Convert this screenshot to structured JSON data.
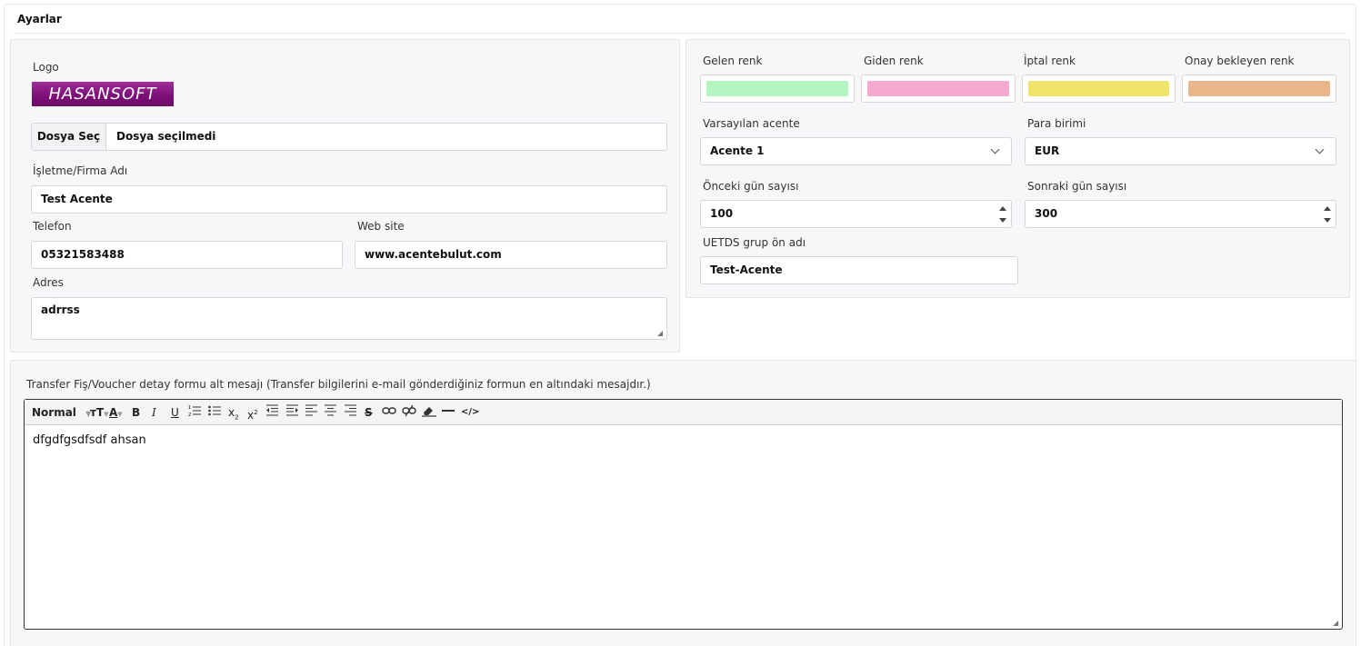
{
  "header": {
    "title": "Ayarlar"
  },
  "company": {
    "logo_label": "Logo",
    "logo_text": "HASANSOFT",
    "file_button": "Dosya Seç",
    "file_status": "Dosya seçilmedi",
    "name_label": "İşletme/Firma Adı",
    "name_value": "Test Acente",
    "phone_label": "Telefon",
    "phone_value": "05321583488",
    "website_label": "Web site",
    "website_value": "www.acentebulut.com",
    "address_label": "Adres",
    "address_value": "adrrss"
  },
  "colors": {
    "incoming_label": "Gelen renk",
    "incoming_color": "#b3f5c0",
    "outgoing_label": "Giden renk",
    "outgoing_color": "#f5a9cf",
    "cancel_label": "İptal renk",
    "cancel_color": "#f0e36a",
    "pending_label": "Onay bekleyen renk",
    "pending_color": "#e8b68a"
  },
  "defaults": {
    "agency_label": "Varsayılan acente",
    "agency_value": "Acente 1",
    "currency_label": "Para birimi",
    "currency_value": "EUR",
    "prev_days_label": "Önceki gün sayısı",
    "prev_days_value": "100",
    "next_days_label": "Sonraki gün sayısı",
    "next_days_value": "300",
    "uetds_label": "UETDS grup ön adı",
    "uetds_value": "Test-Acente"
  },
  "voucher": {
    "label": "Transfer Fiş/Voucher detay formu alt mesajı (Transfer bilgilerini e-mail gönderdiğiniz formun en altındaki mesajdır.)",
    "format_select": "Normal",
    "body": "dfgdfgsdfsdf ahsan"
  },
  "toolbar_icons": [
    "font-size-icon",
    "text-color-icon",
    "bold-icon",
    "italic-icon",
    "underline-icon",
    "ordered-list-icon",
    "bullet-list-icon",
    "subscript-icon",
    "superscript-icon",
    "outdent-icon",
    "indent-icon",
    "align-left-icon",
    "align-center-icon",
    "align-right-icon",
    "strikethrough-icon",
    "link-icon",
    "unlink-icon",
    "clear-format-icon",
    "horizontal-rule-icon",
    "code-view-icon"
  ]
}
